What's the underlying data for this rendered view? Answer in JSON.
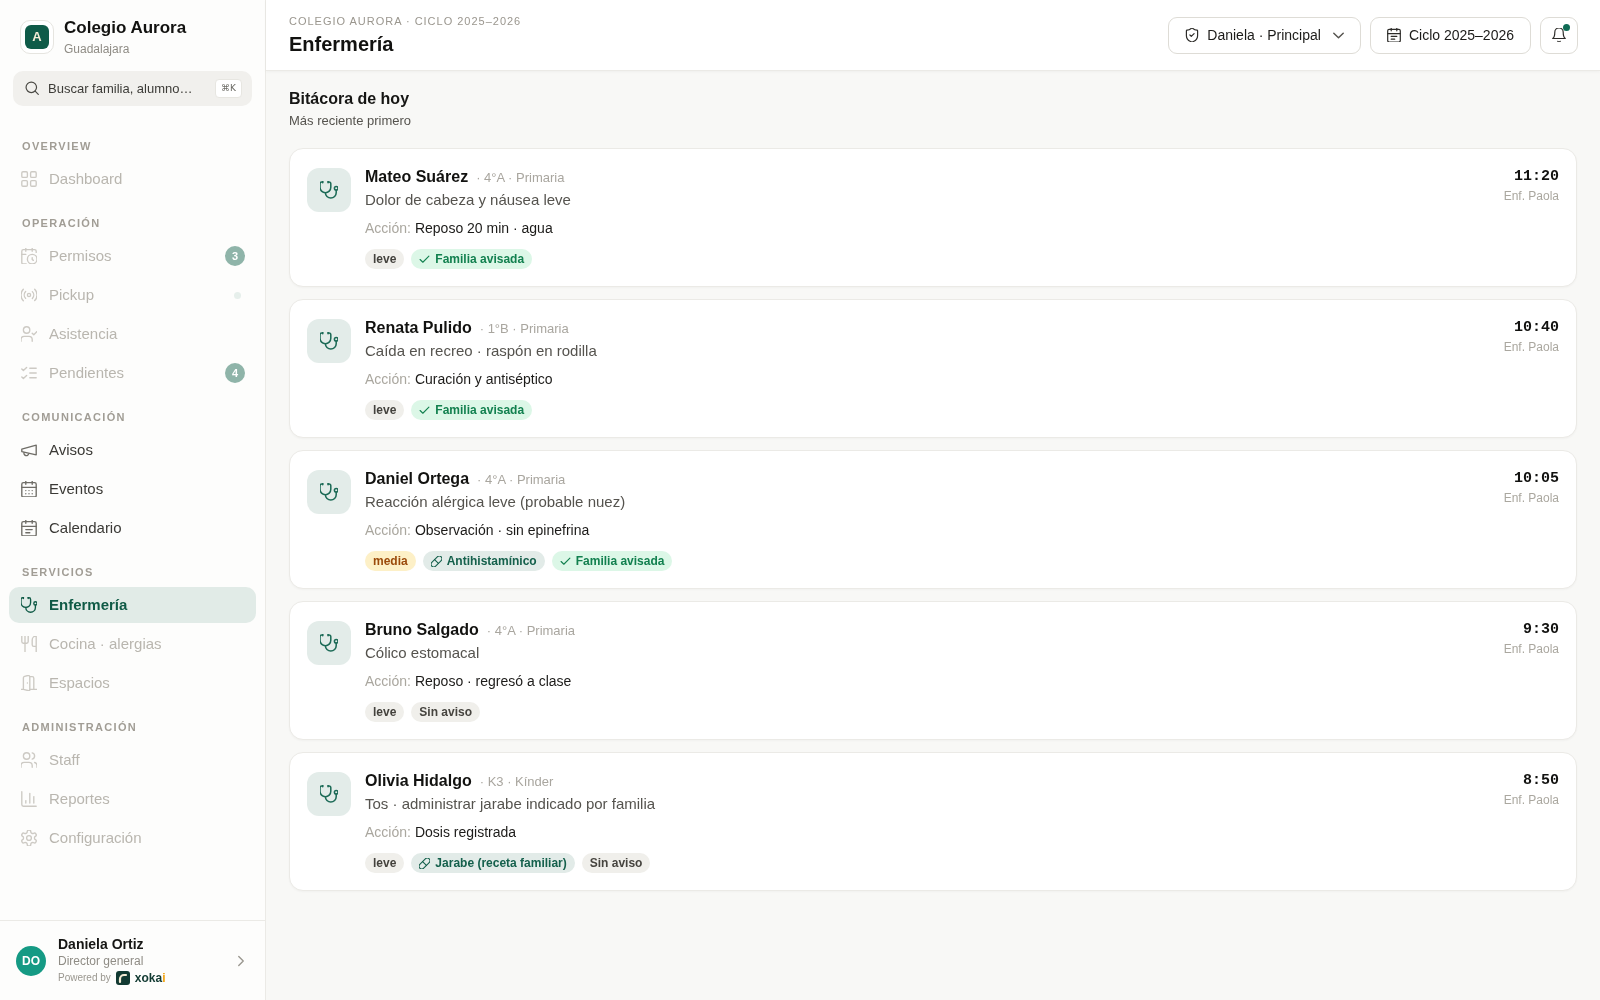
{
  "sidebar": {
    "school": {
      "logo_letter": "A",
      "name": "Colegio Aurora",
      "city": "Guadalajara"
    },
    "search": {
      "placeholder": "Buscar familia, alumno…",
      "shortcut": "⌘K"
    },
    "sections": [
      {
        "title": "OVERVIEW",
        "items": [
          {
            "label": "Dashboard",
            "selected": false,
            "disabled": true,
            "live": false
          }
        ]
      },
      {
        "title": "OPERACIÓN",
        "items": [
          {
            "label": "Permisos",
            "selected": false,
            "disabled": true,
            "live": false,
            "badge": "3"
          },
          {
            "label": "Pickup",
            "selected": false,
            "disabled": true,
            "live": true
          },
          {
            "label": "Asistencia",
            "selected": false,
            "disabled": true,
            "live": false
          },
          {
            "label": "Pendientes",
            "selected": false,
            "disabled": true,
            "live": false,
            "badge": "4"
          }
        ]
      },
      {
        "title": "COMUNICACIÓN",
        "items": [
          {
            "label": "Avisos",
            "selected": false,
            "disabled": false,
            "live": false
          },
          {
            "label": "Eventos",
            "selected": false,
            "disabled": false,
            "live": false
          },
          {
            "label": "Calendario",
            "selected": false,
            "disabled": false,
            "live": false
          }
        ]
      },
      {
        "title": "SERVICIOS",
        "items": [
          {
            "label": "Enfermería",
            "selected": true,
            "disabled": false,
            "live": false
          },
          {
            "label": "Cocina · alergias",
            "selected": false,
            "disabled": true,
            "live": false
          },
          {
            "label": "Espacios",
            "selected": false,
            "disabled": true,
            "live": false
          }
        ]
      },
      {
        "title": "ADMINISTRACIÓN",
        "items": [
          {
            "label": "Staff",
            "selected": false,
            "disabled": true,
            "live": false
          },
          {
            "label": "Reportes",
            "selected": false,
            "disabled": true,
            "live": false
          },
          {
            "label": "Configuración",
            "selected": false,
            "disabled": true,
            "live": false
          }
        ]
      }
    ],
    "user": {
      "initials": "DO",
      "name": "Daniela Ortiz",
      "role": "Director general",
      "powered_by": "Powered by",
      "brand": "xoka",
      "brand_accent": "i"
    }
  },
  "header": {
    "breadcrumb": "COLEGIO AURORA · CICLO 2025–2026",
    "title": "Enfermería",
    "role_menu": "Daniela · Principal",
    "cycle_button": "Ciclo 2025–2026",
    "notifications_unread": true
  },
  "log": {
    "title": "Bitácora de hoy",
    "subtitle": "Más reciente primero",
    "entries": [
      {
        "student": "Mateo Suárez",
        "meta": "· 4°A · Primaria",
        "description": "Dolor de cabeza y náusea leve",
        "action_label": "Acción:",
        "action": "Reposo 20 min · agua",
        "tags": [
          {
            "kind": "mild",
            "label": "leve"
          },
          {
            "kind": "notified",
            "label": "Familia avisada"
          }
        ],
        "time": "11:20",
        "nurse": "Enf. Paola"
      },
      {
        "student": "Renata Pulido",
        "meta": "· 1°B · Primaria",
        "description": "Caída en recreo · raspón en rodilla",
        "action_label": "Acción:",
        "action": "Curación y antiséptico",
        "tags": [
          {
            "kind": "mild",
            "label": "leve"
          },
          {
            "kind": "notified",
            "label": "Familia avisada"
          }
        ],
        "time": "10:40",
        "nurse": "Enf. Paola"
      },
      {
        "student": "Daniel Ortega",
        "meta": "· 4°A · Primaria",
        "description": "Reacción alérgica leve (probable nuez)",
        "action_label": "Acción:",
        "action": "Observación · sin epinefrina",
        "tags": [
          {
            "kind": "moderate",
            "label": "media"
          },
          {
            "kind": "medication",
            "label": "Antihistamínico"
          },
          {
            "kind": "notified",
            "label": "Familia avisada"
          }
        ],
        "time": "10:05",
        "nurse": "Enf. Paola"
      },
      {
        "student": "Bruno Salgado",
        "meta": "· 4°A · Primaria",
        "description": "Cólico estomacal",
        "action_label": "Acción:",
        "action": "Reposo · regresó a clase",
        "tags": [
          {
            "kind": "mild",
            "label": "leve"
          },
          {
            "kind": "unnotified",
            "label": "Sin aviso"
          }
        ],
        "time": "9:30",
        "nurse": "Enf. Paola"
      },
      {
        "student": "Olivia Hidalgo",
        "meta": "· K3 · Kínder",
        "description": "Tos · administrar jarabe indicado por familia",
        "action_label": "Acción:",
        "action": "Dosis registrada",
        "tags": [
          {
            "kind": "mild",
            "label": "leve"
          },
          {
            "kind": "medication",
            "label": "Jarabe (receta familiar)"
          },
          {
            "kind": "unnotified",
            "label": "Sin aviso"
          }
        ],
        "time": "8:50",
        "nurse": "Enf. Paola"
      }
    ]
  }
}
